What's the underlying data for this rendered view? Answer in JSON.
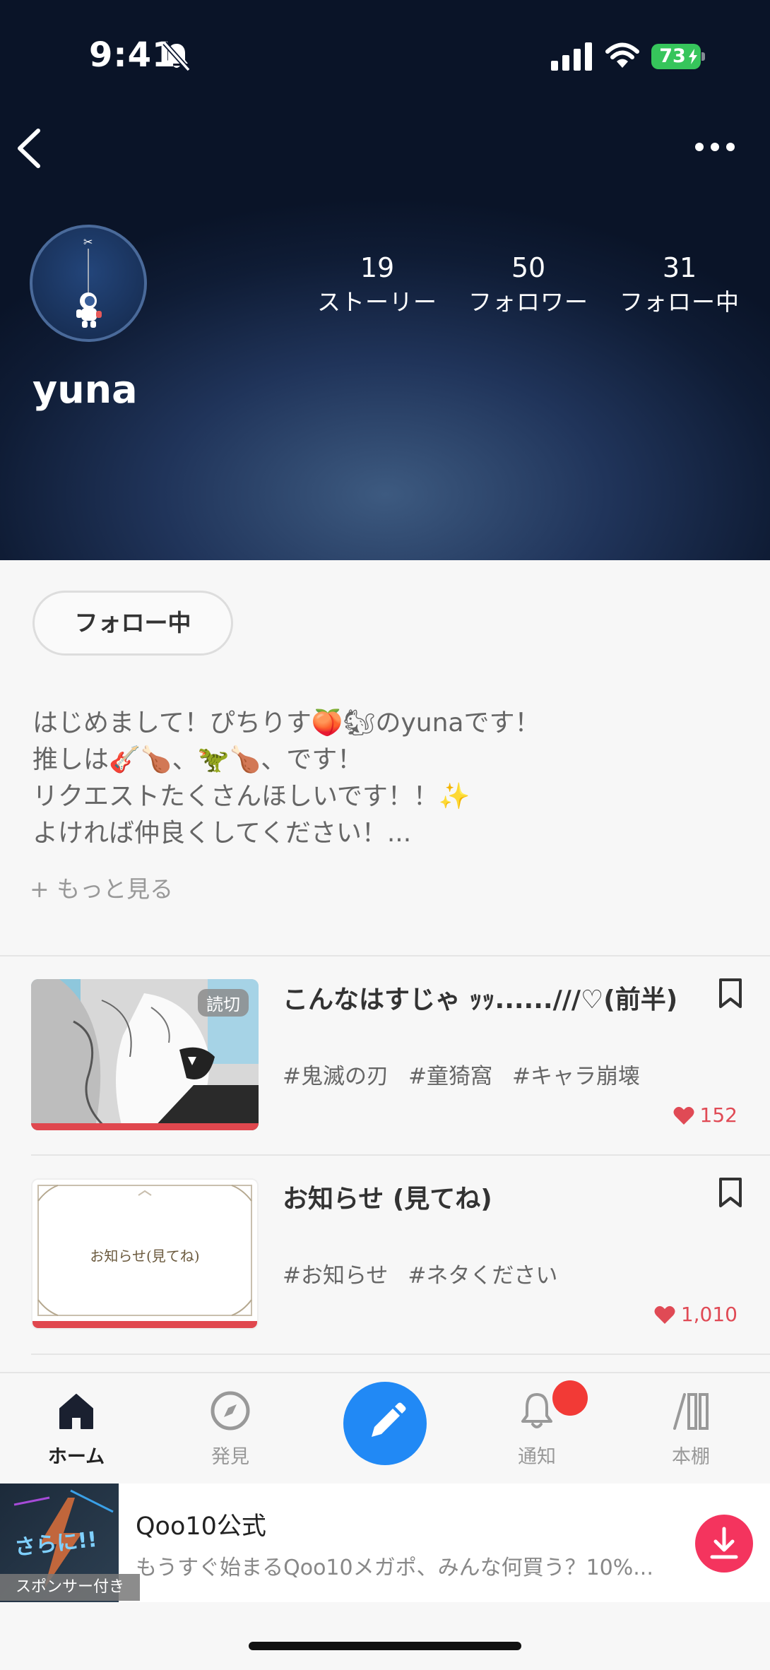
{
  "status_bar": {
    "time": "9:41",
    "battery": "73"
  },
  "profile": {
    "username": "yuna",
    "stats": [
      {
        "count": "19",
        "label": "ストーリー"
      },
      {
        "count": "50",
        "label": "フォロワー"
      },
      {
        "count": "31",
        "label": "フォロー中"
      }
    ],
    "follow_button": "フォロー中",
    "bio_lines": [
      "はじめまして！ぴちりす🍑🐿のyunaです！",
      "推しは🎸🍗、🦖🍗、です！",
      "リクエストたくさんほしいです！！✨",
      "よければ仲良くしてください！..."
    ],
    "more_link": "+ もっと見る"
  },
  "stories": [
    {
      "title": "こんなはすじゃ ｯｯ......///♡(前半)",
      "badge": "読切",
      "tags": [
        "#鬼滅の刃",
        "#童猗窩",
        "#キャラ崩壊"
      ],
      "likes": "152"
    },
    {
      "title": "お知らせ (見てね)",
      "thumb_text": "お知らせ(見てね)",
      "tags": [
        "#お知らせ",
        "#ネタください"
      ],
      "likes": "1,010"
    }
  ],
  "tabbar": {
    "home": "ホーム",
    "discover": "発見",
    "notifications": "通知",
    "bookshelf": "本棚"
  },
  "ad": {
    "image_text": "さらに!!",
    "sponsor_label": "スポンサー付き",
    "title": "Qoo10公式",
    "description": "もうすぐ始まるQoo10メガポ、みんな何買う？10%..."
  },
  "colors": {
    "accent_blue": "#2189f5",
    "like_red": "#e04a55",
    "notif_red": "#f23a36",
    "battery_green": "#36c55b"
  }
}
